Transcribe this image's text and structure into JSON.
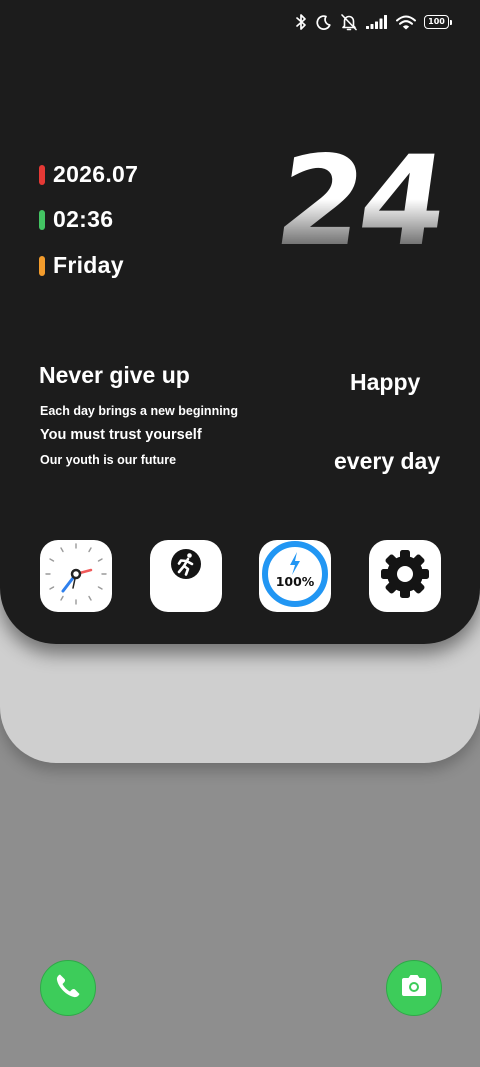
{
  "status_bar": {
    "battery": "100",
    "icons": [
      "bluetooth-icon",
      "moon-icon",
      "bell-off-icon",
      "signal-icon",
      "wifi-icon",
      "battery-icon"
    ]
  },
  "widget": {
    "date": "2026.07",
    "time": "02:36",
    "weekday": "Friday",
    "day": "24",
    "bar_colors": {
      "date": "#e53935",
      "time": "#43c463",
      "weekday": "#f39c2c"
    }
  },
  "quotes": {
    "title": "Never give up",
    "lines": [
      "Each day brings a new beginning",
      "You must trust yourself",
      "Our youth is our future"
    ],
    "happy": "Happy",
    "every_day": "every day"
  },
  "apps": [
    {
      "name": "clock-app",
      "icon": "clock-icon"
    },
    {
      "name": "fitness-app",
      "icon": "running-icon"
    },
    {
      "name": "battery-app",
      "icon": "battery-charge-icon",
      "percent": "100%"
    },
    {
      "name": "settings-app",
      "icon": "gear-icon"
    }
  ],
  "dock": [
    {
      "name": "phone-app",
      "icon": "phone-icon"
    },
    {
      "name": "camera-app",
      "icon": "camera-icon"
    }
  ],
  "colors": {
    "wallpaper": "#8e8e8e",
    "card": "#1c1c1c",
    "back_card": "#cfcfcf",
    "accent_blue": "#2196f3",
    "dock_green": "#3dcc5a"
  }
}
